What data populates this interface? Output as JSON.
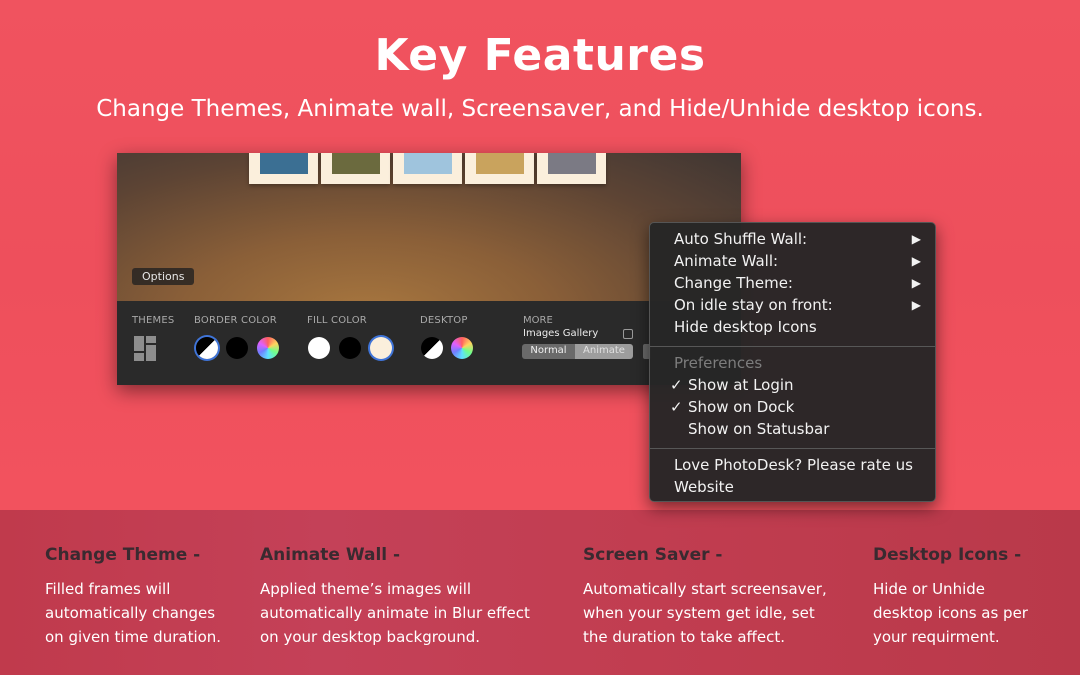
{
  "header": {
    "title": "Key Features",
    "subtitle": "Change Themes, Animate wall, Screensaver, and Hide/Unhide desktop icons."
  },
  "app_window": {
    "frames": [
      {
        "photo": "harbor-photo",
        "color": "#3b6f93"
      },
      {
        "photo": "grass-photo",
        "color": "#6b6a3e"
      },
      {
        "photo": "baby-photo",
        "color": "#9fc4dd"
      },
      {
        "photo": "giraffes-photo",
        "color": "#c9a35d"
      },
      {
        "photo": "family-photo",
        "color": "#7b7a84"
      }
    ],
    "options_label": "Options",
    "toolbar": {
      "themes_label": "THEMES",
      "border_color_label": "BORDER COLOR",
      "fill_color_label": "FILL COLOR",
      "desktop_label": "DESKTOP",
      "more_label": "MORE",
      "images_gallery_label": "Images Gallery",
      "images_gallery_checked": false,
      "segment_normal": "Normal",
      "segment_animate": "Animate",
      "segment_selected": "Normal"
    }
  },
  "menu": {
    "items": [
      {
        "label": "Auto Shuffle Wall:",
        "submenu": true
      },
      {
        "label": "Animate Wall:",
        "submenu": true
      },
      {
        "label": "Change Theme:",
        "submenu": true
      },
      {
        "label": "On idle stay on front:",
        "submenu": true
      },
      {
        "label": "Hide desktop Icons",
        "submenu": false
      }
    ],
    "arrow_glyph": "▶",
    "preferences_header": "Preferences",
    "preferences": [
      {
        "label": "Show at Login",
        "checked": true
      },
      {
        "label": "Show on Dock",
        "checked": true
      },
      {
        "label": "Show on Statusbar",
        "checked": false
      }
    ],
    "check_glyph": "✓",
    "footer": [
      {
        "label": "Love PhotoDesk? Please rate us"
      },
      {
        "label": "Website"
      }
    ]
  },
  "features": [
    {
      "title": "Change Theme -",
      "lines": [
        "Filled frames will",
        "automatically changes",
        "on given time duration."
      ]
    },
    {
      "title": "Animate Wall -",
      "lines": [
        "Applied theme’s images will",
        "automatically animate in Blur effect",
        "on your desktop background."
      ]
    },
    {
      "title": "Screen Saver -",
      "lines": [
        "Automatically start screensaver,",
        "when your system get idle, set",
        "the duration to take affect."
      ]
    },
    {
      "title": "Desktop Icons -",
      "lines": [
        "Hide or Unhide",
        "desktop icons as per",
        "your requirment."
      ]
    }
  ]
}
